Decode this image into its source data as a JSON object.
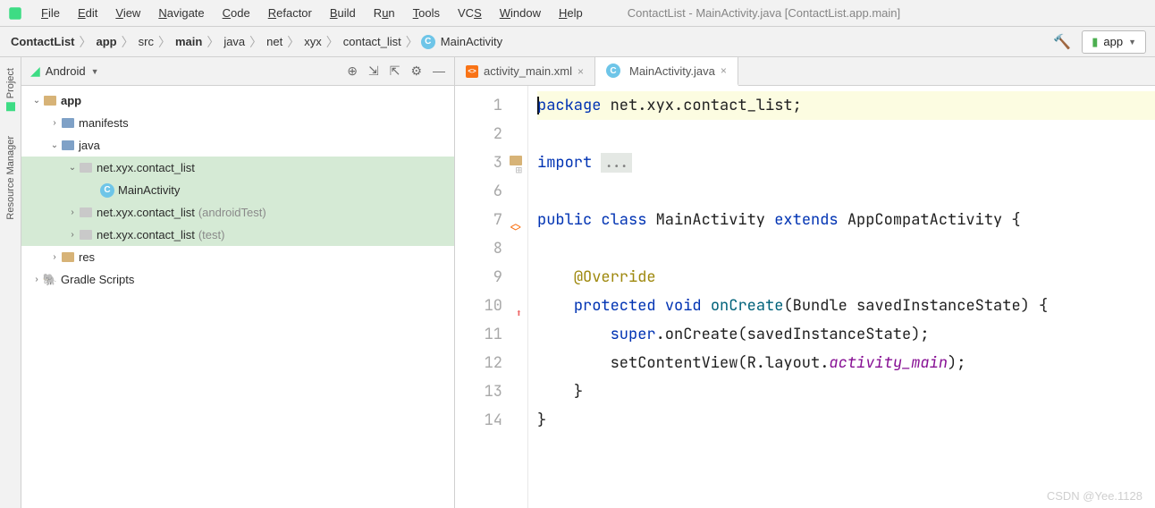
{
  "menu": {
    "items": [
      "File",
      "Edit",
      "View",
      "Navigate",
      "Code",
      "Refactor",
      "Build",
      "Run",
      "Tools",
      "VCS",
      "Window",
      "Help"
    ],
    "title": "ContactList - MainActivity.java [ContactList.app.main]"
  },
  "breadcrumbs": {
    "project": "ContactList",
    "parts": [
      "app",
      "src",
      "main",
      "java",
      "net",
      "xyx",
      "contact_list"
    ],
    "file": "MainActivity"
  },
  "runConfig": "app",
  "projectView": {
    "title": "Android",
    "nodes": {
      "app": "app",
      "manifests": "manifests",
      "java": "java",
      "pkg_main": "net.xyx.contact_list",
      "main_activity": "MainActivity",
      "pkg_atest": "net.xyx.contact_list",
      "pkg_atest_suffix": "(androidTest)",
      "pkg_test": "net.xyx.contact_list",
      "pkg_test_suffix": "(test)",
      "res": "res",
      "gradle": "Gradle Scripts"
    }
  },
  "tabs": {
    "t0": "activity_main.xml",
    "t1": "MainActivity.java"
  },
  "sideLabels": {
    "project": "Project",
    "resmgr": "Resource Manager"
  },
  "code": {
    "gutters": [
      "1",
      "2",
      "3",
      "6",
      "7",
      "8",
      "9",
      "10",
      "11",
      "12",
      "13",
      "14"
    ],
    "l1_kw": "package",
    "l1_rest": " net.xyx.contact_list;",
    "l3_kw": "import",
    "l3_rest": " ",
    "l3_dots": "...",
    "l7_kw1": "public",
    "l7_kw2": "class",
    "l7_name": "MainActivity",
    "l7_kw3": "extends",
    "l7_sup": "AppCompatActivity",
    "l7_br": " {",
    "l9_at": "@Override",
    "l10_kw1": "protected",
    "l10_kw2": "void",
    "l10_fn": "onCreate",
    "l10_par": "(Bundle savedInstanceState) {",
    "l11_sup": "super",
    "l11_rest": ".onCreate(savedInstanceState);",
    "l12_a": "setContentView(R.layout.",
    "l12_b": "activity_main",
    "l12_c": ");",
    "l13": "}",
    "l14": "}"
  },
  "watermark": "CSDN @Yee.1128"
}
